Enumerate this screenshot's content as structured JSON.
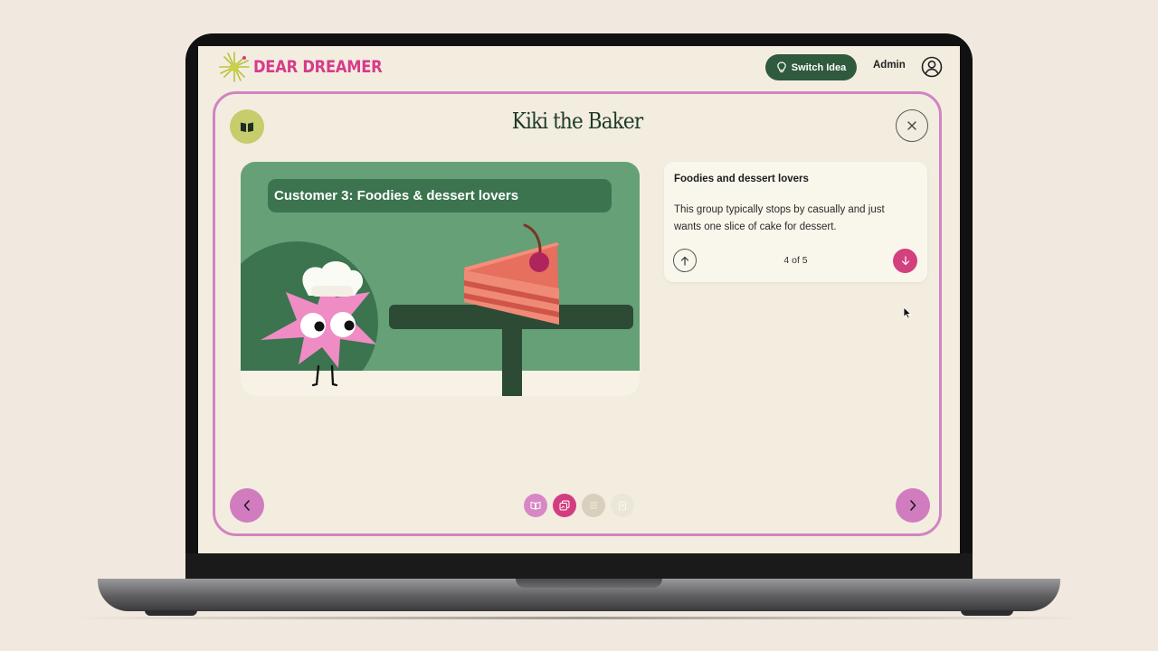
{
  "header": {
    "logo_text": "DEAR DREAMER",
    "switch_button": "Switch Idea",
    "admin_label": "Admin"
  },
  "panel": {
    "title": "Kiki the Baker",
    "scene_caption": "Customer 3: Foodies & dessert lovers",
    "card": {
      "title": "Foodies and dessert lovers",
      "body": "This group typically stops by casually and just wants one slice of cake for dessert.",
      "counter": "4 of 5"
    },
    "steps": [
      {
        "icon": "book-icon",
        "state": "visited"
      },
      {
        "icon": "gallery-icon",
        "state": "active"
      },
      {
        "icon": "list-icon",
        "state": "upcoming"
      },
      {
        "icon": "document-icon",
        "state": "disabled"
      }
    ]
  },
  "colors": {
    "page_background": "#f1e9df",
    "screen_background": "#f3ede0",
    "brand_pink": "#d63c8a",
    "panel_border": "#d184c1",
    "dark_green": "#2f5a3d",
    "scene_green": "#66a077",
    "olive_button": "#c7cc6c"
  }
}
